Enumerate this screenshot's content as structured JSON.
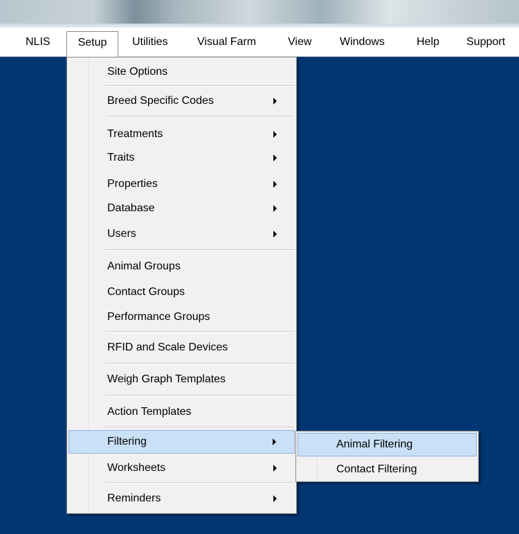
{
  "menubar": {
    "items": [
      "NLIS",
      "Setup",
      "Utilities",
      "Visual Farm",
      "View",
      "Windows",
      "Help",
      "Support"
    ]
  },
  "setup_menu": {
    "items": [
      {
        "label": "Site Options",
        "has_submenu": false
      },
      {
        "label": "Breed Specific Codes",
        "has_submenu": true
      },
      {
        "label": "Treatments",
        "has_submenu": true
      },
      {
        "label": "Traits",
        "has_submenu": true
      },
      {
        "label": "Properties",
        "has_submenu": true
      },
      {
        "label": "Database",
        "has_submenu": true
      },
      {
        "label": "Users",
        "has_submenu": true
      },
      {
        "label": "Animal Groups",
        "has_submenu": false
      },
      {
        "label": "Contact Groups",
        "has_submenu": false
      },
      {
        "label": "Performance Groups",
        "has_submenu": false
      },
      {
        "label": "RFID and Scale Devices",
        "has_submenu": false
      },
      {
        "label": "Weigh Graph Templates",
        "has_submenu": false
      },
      {
        "label": "Action Templates",
        "has_submenu": false
      },
      {
        "label": "Filtering",
        "has_submenu": true,
        "highlighted": true
      },
      {
        "label": "Worksheets",
        "has_submenu": true
      },
      {
        "label": "Reminders",
        "has_submenu": true
      }
    ]
  },
  "filtering_submenu": {
    "items": [
      {
        "label": "Animal Filtering",
        "highlighted": true
      },
      {
        "label": "Contact Filtering"
      }
    ]
  },
  "colors": {
    "desktop": "#003773",
    "highlight": "#c9e0f7",
    "highlight_border": "#8fb4dc",
    "menu_bg": "#f1f1f1"
  }
}
